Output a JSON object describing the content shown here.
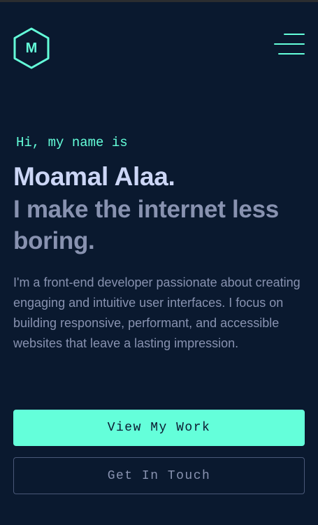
{
  "header": {
    "logo_letter": "M",
    "menu_icon": "hamburger-menu-icon"
  },
  "hero": {
    "greeting": "Hi, my name is",
    "name": "Moamal Alaa.",
    "tagline": "I make the internet less boring.",
    "bio": "I'm a front-end developer passionate about creating engaging and intuitive user interfaces. I focus on building responsive, performant, and accessible websites that leave a lasting impression."
  },
  "actions": {
    "primary_label": "View My Work",
    "secondary_label": "Get In Touch"
  },
  "colors": {
    "background": "#0a192f",
    "accent": "#64ffda",
    "heading": "#ccd6f6",
    "muted": "#8892b0"
  }
}
